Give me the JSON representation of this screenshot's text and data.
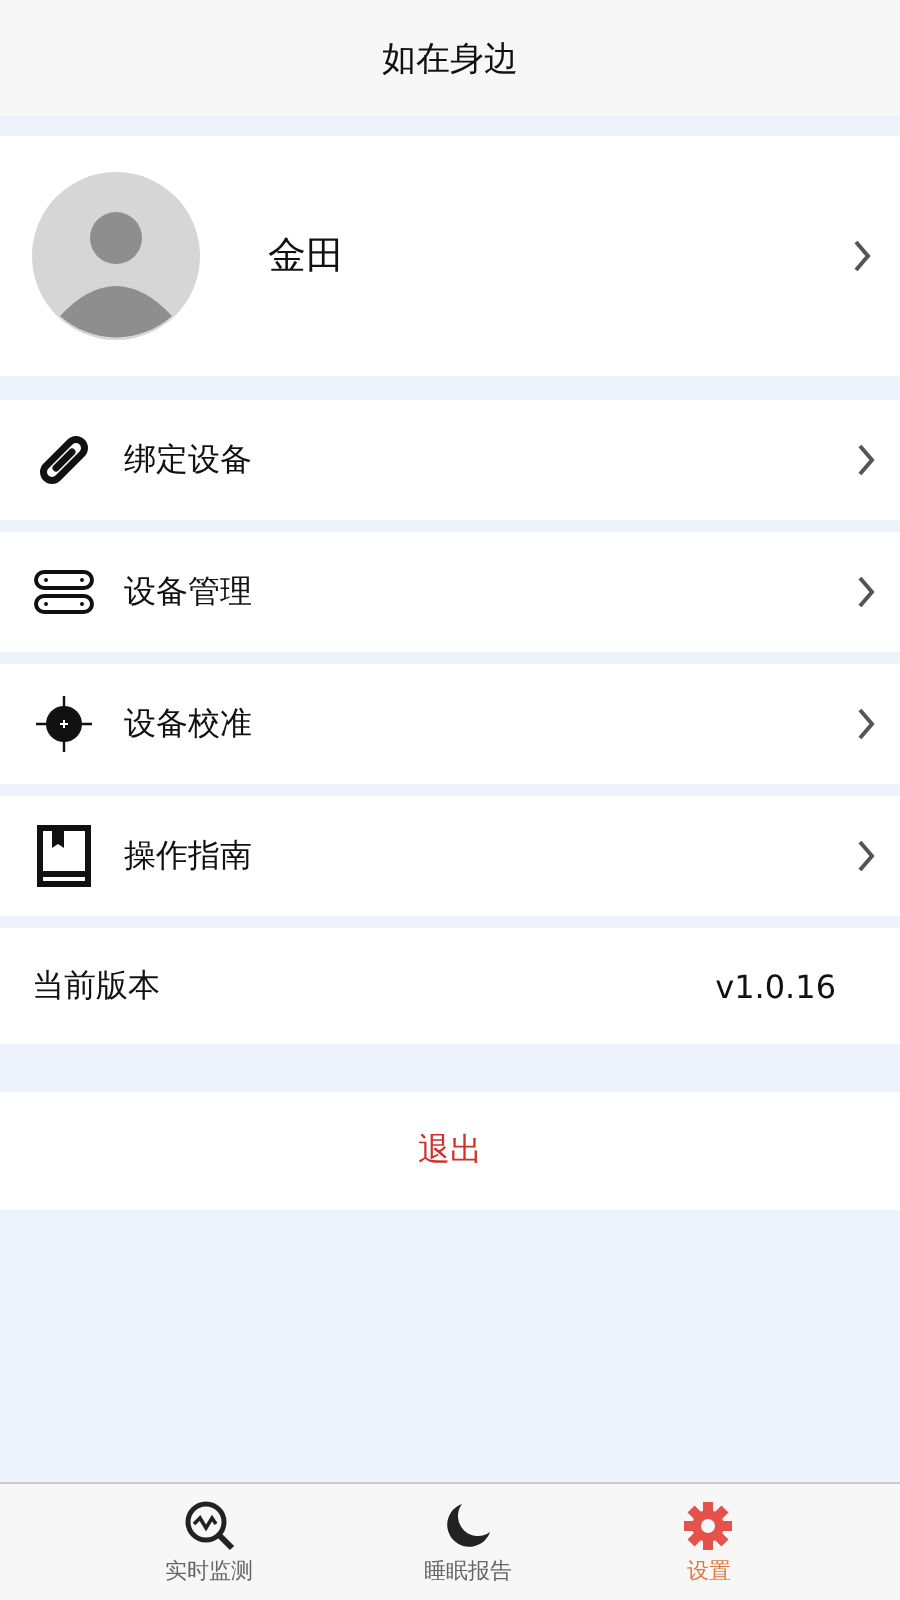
{
  "header": {
    "title": "如在身边"
  },
  "profile": {
    "name": "金田"
  },
  "menu": [
    {
      "kind": "link",
      "label": "绑定设备"
    },
    {
      "kind": "strip",
      "label": "设备管理"
    },
    {
      "kind": "target",
      "label": "设备校准"
    },
    {
      "kind": "book",
      "label": "操作指南"
    }
  ],
  "version": {
    "label": "当前版本",
    "value": "v1.0.16"
  },
  "logout": {
    "label": "退出"
  },
  "tabs": [
    {
      "kind": "monitor",
      "label": "实时监测",
      "selected": false
    },
    {
      "kind": "moon",
      "label": "睡眠报告",
      "selected": false
    },
    {
      "kind": "gear",
      "label": "设置",
      "selected": true
    }
  ]
}
